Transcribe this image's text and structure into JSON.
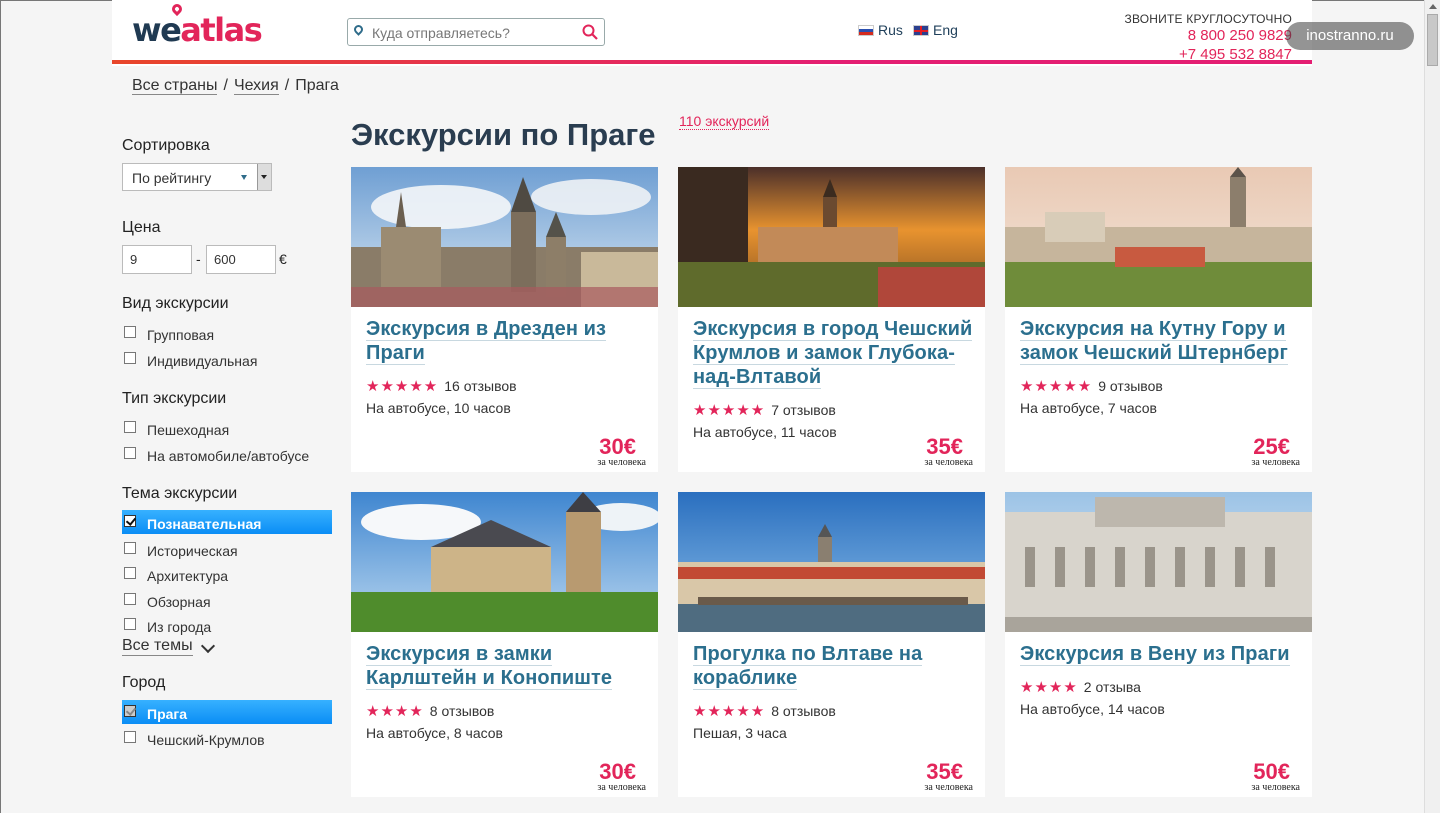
{
  "header": {
    "logo_we": "we",
    "logo_atlas": "atlas",
    "search_placeholder": "Куда отправляетесь?",
    "lang_ru": "Rus",
    "lang_en": "Eng",
    "phone_caption": "ЗВОНИТЕ КРУГЛОСУТОЧНО",
    "phone1": "8 800 250 9829",
    "phone2": "+7 495 532 8847",
    "watermark": "inostranno.ru"
  },
  "breadcrumb": [
    "Все страны",
    "Чехия",
    "Прага"
  ],
  "sidebar": {
    "sort_title": "Сортировка",
    "sort_value": "По рейтингу",
    "price_title": "Цена",
    "price_min": "9",
    "price_max": "600",
    "currency": "€",
    "dash": "-",
    "kind_title": "Вид экскурсии",
    "kind_items": [
      "Групповая",
      "Индивидуальная"
    ],
    "type_title": "Тип экскурсии",
    "type_items": [
      "Пешеходная",
      "На автомобиле/автобусе"
    ],
    "theme_title": "Тема экскурсии",
    "theme_items": [
      "Познавательная",
      "Историческая",
      "Архитектура",
      "Обзорная",
      "Из города"
    ],
    "all_themes": "Все темы",
    "city_title": "Город",
    "city_items": [
      "Прага",
      "Чешский-Крумлов"
    ]
  },
  "main": {
    "title": "Экскурсии по Праге",
    "count": "110 экскурсий",
    "per_person": "за человека",
    "cards": [
      {
        "title": "Экскурсия в Дрезден из Праги",
        "stars": "★★★★★",
        "reviews": "16 отзывов",
        "meta": "На автобусе,  10 часов",
        "price": "30€"
      },
      {
        "title": "Экскурсия в город Чешский Крумлов и замок Глубока-над-Влтавой",
        "stars": "★★★★★",
        "reviews": "7 отзывов",
        "meta": "На автобусе,  11 часов",
        "price": "35€"
      },
      {
        "title": "Экскурсия на Кутну Гору и замок Чешский Штернберг",
        "stars": "★★★★★",
        "reviews": "9 отзывов",
        "meta": "На автобусе,  7 часов",
        "price": "25€"
      },
      {
        "title": "Экскурсия в замки Карлштейн и Конопиште",
        "stars": "★★★★",
        "reviews": "8 отзывов",
        "meta": "На автобусе,  8 часов",
        "price": "30€"
      },
      {
        "title": "Прогулка по Влтаве на кораблике",
        "stars": "★★★★★",
        "reviews": "8 отзывов",
        "meta": "Пешая,  3 часа",
        "price": "35€"
      },
      {
        "title": "Экскурсия в Вену из Праги",
        "stars": "★★★★",
        "reviews": "2 отзыва",
        "meta": "На автобусе,  14 часов",
        "price": "50€"
      }
    ]
  }
}
